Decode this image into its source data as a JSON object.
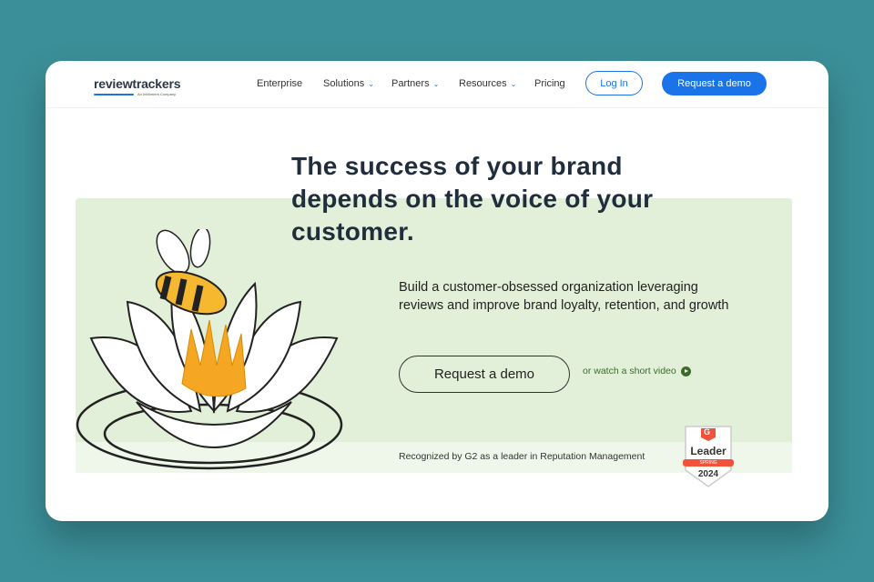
{
  "brand": {
    "name": "reviewtrackers",
    "tagline": "An InMoment Company"
  },
  "nav": {
    "items": [
      {
        "label": "Enterprise",
        "dropdown": false
      },
      {
        "label": "Solutions",
        "dropdown": true
      },
      {
        "label": "Partners",
        "dropdown": true
      },
      {
        "label": "Resources",
        "dropdown": true
      },
      {
        "label": "Pricing",
        "dropdown": false
      }
    ],
    "login": "Log In",
    "demo": "Request a demo"
  },
  "hero": {
    "headline": "The success of your brand depends on the voice of your customer.",
    "subtext": "Build a customer-obsessed organization leveraging reviews and improve brand loyalty, retention, and growth",
    "cta": "Request a demo",
    "video_link": "or watch a short video",
    "recognition": "Recognized by G2 as a leader in Reputation Management"
  },
  "badge": {
    "logo": "G",
    "title": "Leader",
    "season": "SPRING",
    "year": "2024"
  },
  "colors": {
    "accent": "#1a73e8",
    "panel": "#e3f0d9",
    "background": "#3b8f98",
    "badge_red": "#f0533a"
  }
}
